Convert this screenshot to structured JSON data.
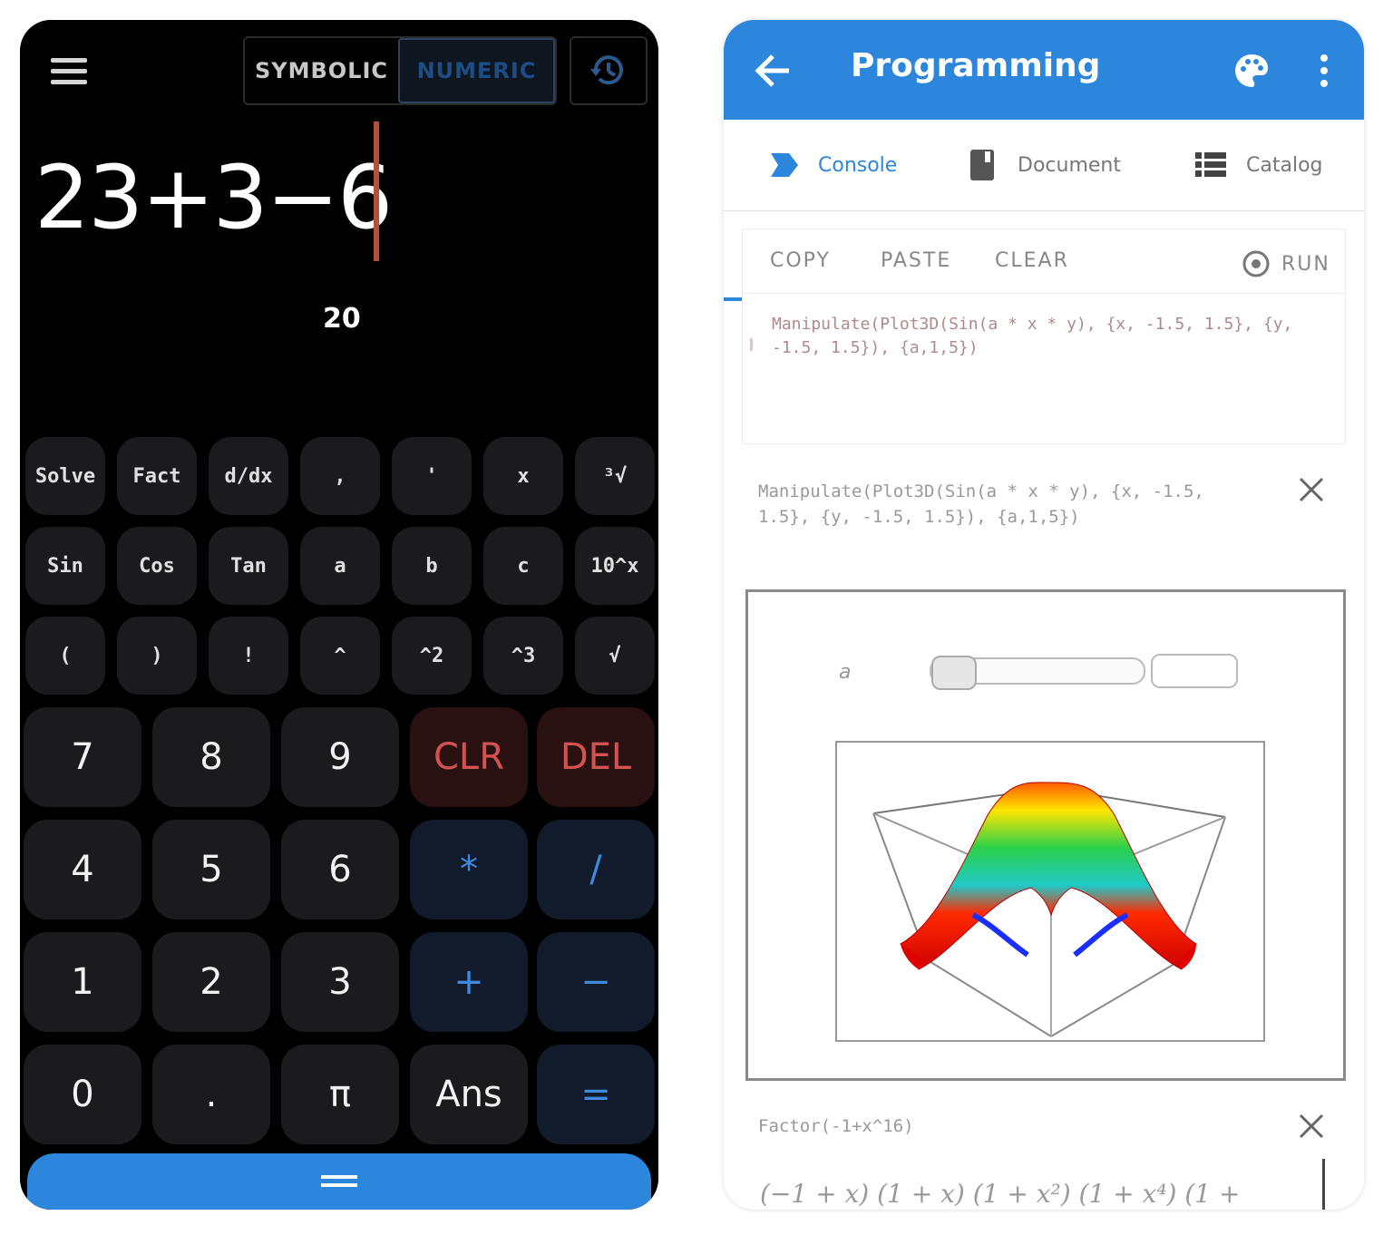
{
  "calculator": {
    "mode_symbolic": "SYMBOLIC",
    "mode_numeric": "NUMERIC",
    "expression": "23+3−6",
    "result": "20",
    "function_rows": [
      [
        "Solve",
        "Fact",
        "d/dx",
        ",",
        "'",
        "x",
        "³√"
      ],
      [
        "Sin",
        "Cos",
        "Tan",
        "a",
        "b",
        "c",
        "10^x"
      ],
      [
        "(",
        ")",
        "!",
        "^",
        "^2",
        "^3",
        "√"
      ]
    ],
    "keypad_rows": [
      [
        "7",
        "8",
        "9",
        "CLR",
        "DEL"
      ],
      [
        "4",
        "5",
        "6",
        "*",
        "/"
      ],
      [
        "1",
        "2",
        "3",
        "+",
        "−"
      ],
      [
        "0",
        ".",
        "π",
        "Ans",
        "="
      ]
    ],
    "colors": {
      "accent": "#2b86dc",
      "clear_delete": "#d45252",
      "operator": "#3f8ae0"
    }
  },
  "programming": {
    "title": "Programming",
    "tabs": [
      {
        "label": "Console",
        "icon": "console-icon"
      },
      {
        "label": "Document",
        "icon": "document-icon"
      },
      {
        "label": "Catalog",
        "icon": "catalog-icon"
      }
    ],
    "actions": {
      "copy": "COPY",
      "paste": "PASTE",
      "clear": "CLEAR",
      "run": "RUN"
    },
    "input_code": "Manipulate(Plot3D(Sin(a * x * y), {x, -1.5, 1.5}, {y, -1.5, 1.5}), {a,1,5})",
    "output_1_expr": "Manipulate(Plot3D(Sin(a * x * y), {x, -1.5, 1.5}, {y, -1.5, 1.5}), {a,1,5})",
    "slider_label": "a",
    "slider_value": 0,
    "output_2_expr": "Factor(-1+x^16)",
    "output_2_result": "(−1 + x) (1 + x) (1 + x²) (1 + x⁴) (1 +",
    "colors": {
      "appbar": "#2b86dc"
    }
  }
}
